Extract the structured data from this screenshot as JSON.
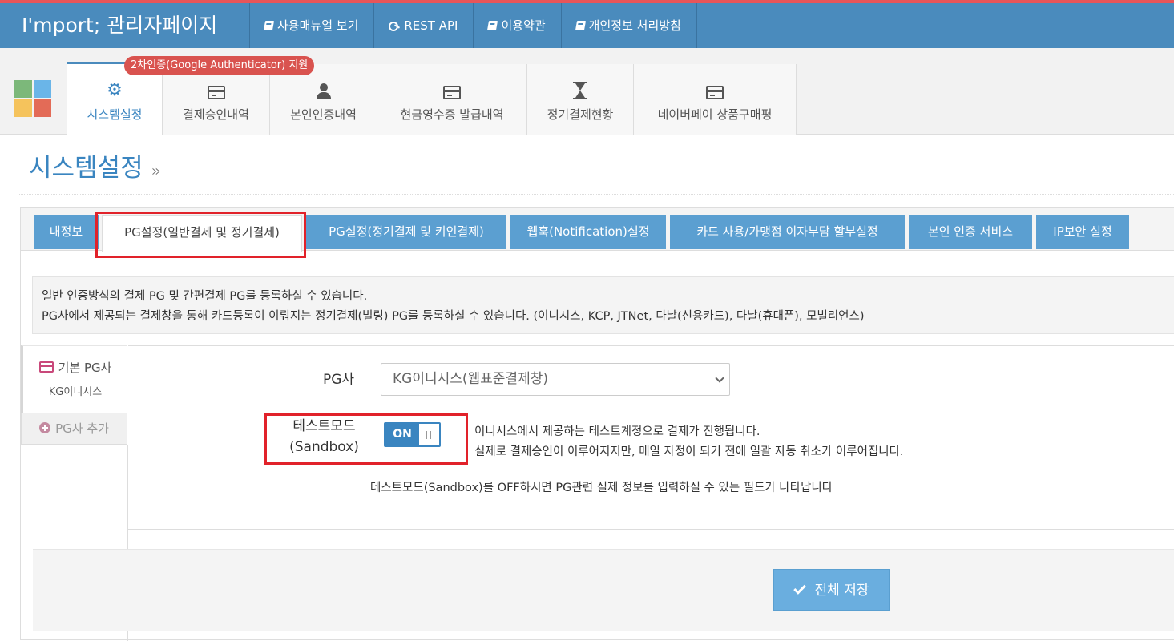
{
  "topbar": {
    "brand": "I'mport; 관리자페이지",
    "nav": [
      {
        "label": "사용매뉴얼 보기",
        "icon": "book-icon"
      },
      {
        "label": "REST API",
        "icon": "key-icon"
      },
      {
        "label": "이용약관",
        "icon": "book-icon"
      },
      {
        "label": "개인정보 처리방침",
        "icon": "book-icon"
      }
    ]
  },
  "subnav": {
    "badge": "2차인증(Google Authenticator) 지원",
    "tabs": [
      {
        "label": "시스템설정",
        "icon": "gear-icon",
        "active": true
      },
      {
        "label": "결제승인내역",
        "icon": "credit-card-icon"
      },
      {
        "label": "본인인증내역",
        "icon": "user-icon"
      },
      {
        "label": "현금영수증 발급내역",
        "icon": "credit-card-icon"
      },
      {
        "label": "정기결제현황",
        "icon": "hourglass-icon"
      },
      {
        "label": "네이버페이 상품구매평",
        "icon": "credit-card-icon"
      }
    ]
  },
  "page": {
    "title": "시스템설정",
    "title_suffix": "»"
  },
  "settings_tabs": [
    {
      "label": "내정보"
    },
    {
      "label": "PG설정(일반결제 및 정기결제)",
      "active": true
    },
    {
      "label": "PG설정(정기결제 및 키인결제)"
    },
    {
      "label": "웹훅(Notification)설정"
    },
    {
      "label": "카드 사용/가맹점 이자부담 할부설정"
    },
    {
      "label": "본인 인증 서비스"
    },
    {
      "label": "IP보안 설정"
    }
  ],
  "info": {
    "line1": "일반 인증방식의 결제 PG 및 간편결제 PG를 등록하실 수 있습니다.",
    "line2": "PG사에서 제공되는 결제창을 통해 카드등록이 이뤄지는 정기결제(빌링) PG를 등록하실 수 있습니다. (이니시스, KCP, JTNet, 다날(신용카드), 다날(휴대폰), 모빌리언스)"
  },
  "pg_list": {
    "default_label": "기본 PG사",
    "default_value": "KG이니시스",
    "add_label": "PG사 추가"
  },
  "form": {
    "pg_label": "PG사",
    "pg_selected": "KG이니시스(웹표준결제창)",
    "test_label_line1": "테스트모드",
    "test_label_line2": "(Sandbox)",
    "toggle_on": "ON",
    "test_desc_line1": "이니시스에서 제공하는 테스트계정으로 결제가 진행됩니다.",
    "test_desc_line2": "실제로 결제승인이 이루어지지만, 매일 자정이 되기 전에 일괄 자동 취소가 이루어집니다.",
    "sandbox_note": "테스트모드(Sandbox)를 OFF하시면 PG관련 실제 정보를 입력하실 수 있는 필드가 나타납니다"
  },
  "save_button": "전체 저장",
  "colors": {
    "brand_blue": "#4a8bbd",
    "accent_red": "#e8555a",
    "tab_blue": "#5b9fd1",
    "highlight_red": "#e1222a"
  }
}
